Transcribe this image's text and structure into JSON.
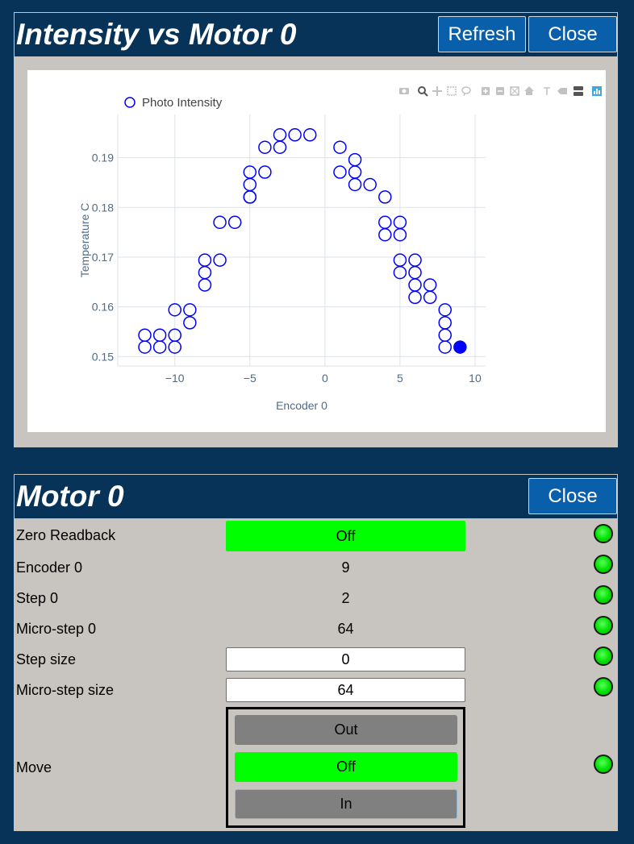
{
  "chart_panel": {
    "title": "Intensity vs Motor 0",
    "refresh_label": "Refresh",
    "close_label": "Close"
  },
  "modebar": {
    "icons": [
      "camera-icon",
      "zoom-icon",
      "pan-icon",
      "box-select-icon",
      "lasso-select-icon",
      "zoom-in-icon",
      "zoom-out-icon",
      "autoscale-icon",
      "reset-axes-icon",
      "spike-lines-icon",
      "hover-closest-icon",
      "hover-compare-icon",
      "plotly-logo-icon"
    ]
  },
  "chart_data": {
    "type": "scatter",
    "xlabel": "Encoder 0",
    "ylabel": "Temperature C",
    "xlim": [
      -13.8,
      10.7
    ],
    "ylim": [
      0.1481,
      0.1987
    ],
    "xticks": [
      -10,
      -5,
      0,
      5,
      10
    ],
    "xtick_labels": [
      "−10",
      "−5",
      "0",
      "5",
      "10"
    ],
    "yticks": [
      0.15,
      0.16,
      0.17,
      0.18,
      0.19
    ],
    "ytick_labels": [
      "0.15",
      "0.16",
      "0.17",
      "0.18",
      "0.19"
    ],
    "grid": true,
    "legend_position": "top-left",
    "series": [
      {
        "name": "Photo Intensity",
        "color": "#0000ff",
        "marker": "open-circle",
        "x": [
          -12,
          -12,
          -11,
          -11,
          -10,
          -10,
          -10,
          -9,
          -9,
          -8,
          -8,
          -8,
          -7,
          -7,
          -6,
          -5,
          -5,
          -5,
          -5,
          -4,
          -4,
          -3,
          -3,
          -2,
          -1,
          1,
          1,
          2,
          2,
          2,
          3,
          4,
          4,
          4,
          5,
          5,
          5,
          5,
          6,
          6,
          6,
          6,
          7,
          7,
          8,
          8,
          8,
          8
        ],
        "y": [
          0.1543,
          0.1519,
          0.1543,
          0.1519,
          0.1594,
          0.1543,
          0.1519,
          0.1594,
          0.1568,
          0.1694,
          0.1669,
          0.1644,
          0.177,
          0.1694,
          0.177,
          0.1871,
          0.1846,
          0.1821,
          0.1821,
          0.1871,
          0.1921,
          0.1946,
          0.1921,
          0.1946,
          0.1946,
          0.1921,
          0.1871,
          0.1896,
          0.1871,
          0.1846,
          0.1846,
          0.1821,
          0.177,
          0.1745,
          0.177,
          0.1745,
          0.1694,
          0.1669,
          0.1694,
          0.1669,
          0.1644,
          0.1619,
          0.1644,
          0.1619,
          0.1594,
          0.1568,
          0.1543,
          0.1519
        ]
      }
    ],
    "current_point": {
      "x": 9,
      "y": 0.1519
    }
  },
  "motor_panel": {
    "title": "Motor 0",
    "close_label": "Close",
    "rows": [
      {
        "label": "Zero Readback",
        "value": "Off"
      },
      {
        "label": "Encoder 0",
        "value": "9"
      },
      {
        "label": "Step 0",
        "value": "2"
      },
      {
        "label": "Micro-step 0",
        "value": "64"
      },
      {
        "label": "Step size",
        "value": "0"
      },
      {
        "label": "Micro-step size",
        "value": "64"
      }
    ],
    "move": {
      "label": "Move",
      "out_label": "Out",
      "state_label": "Off",
      "in_label": "In"
    },
    "led_color": "#00ff00",
    "accent_color": "#0a5faa",
    "header_color": "#083358"
  }
}
